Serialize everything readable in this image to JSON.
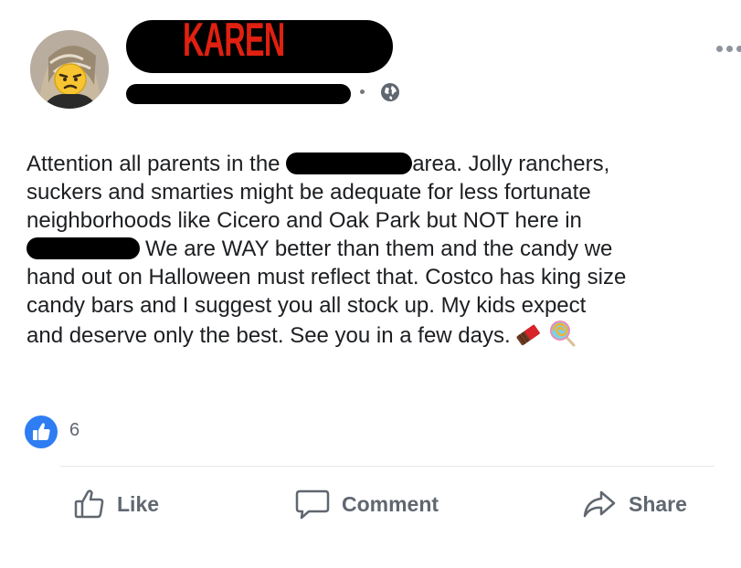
{
  "post": {
    "author_name": "KAREN",
    "text_lines": [
      [
        "Attention all parents in the ",
        "area. Jolly ranchers,"
      ],
      [
        "suckers and smarties might be adequate for less fortunate"
      ],
      [
        "neighborhoods like Cicero and Oak Park but NOT here in"
      ],
      [
        "We are WAY better than them and the candy we"
      ],
      [
        "hand out on Halloween must reflect that. Costco has king size"
      ],
      [
        "candy bars and I suggest you all stock up. My kids expect"
      ],
      [
        "and deserve only the best. See you in a few days."
      ]
    ],
    "emojis": [
      "chocolate-bar-icon",
      "lollipop-icon"
    ],
    "privacy_icon": "globe-icon",
    "more_icon": "more-options-icon"
  },
  "reactions": {
    "icon": "thumbs-up-icon",
    "count": "6"
  },
  "actions": {
    "like_label": "Like",
    "comment_label": "Comment",
    "share_label": "Share"
  },
  "colors": {
    "like_blue": "#2f7df2",
    "name_red": "#e02010",
    "secondary_text": "#606770"
  }
}
